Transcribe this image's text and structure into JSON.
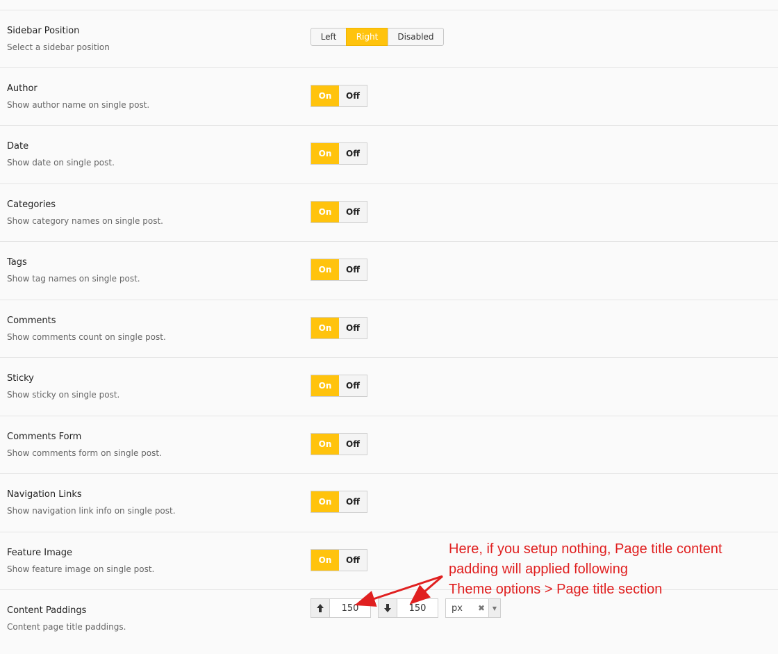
{
  "sidebar_position": {
    "title": "Sidebar Position",
    "description": "Select a sidebar position",
    "options": [
      "Left",
      "Right",
      "Disabled"
    ],
    "selected": "Right"
  },
  "toggles": [
    {
      "title": "Author",
      "description": "Show author name on single post.",
      "on_label": "On",
      "off_label": "Off",
      "state": "On"
    },
    {
      "title": "Date",
      "description": "Show date on single post.",
      "on_label": "On",
      "off_label": "Off",
      "state": "On"
    },
    {
      "title": "Categories",
      "description": "Show category names on single post.",
      "on_label": "On",
      "off_label": "Off",
      "state": "On"
    },
    {
      "title": "Tags",
      "description": "Show tag names on single post.",
      "on_label": "On",
      "off_label": "Off",
      "state": "On"
    },
    {
      "title": "Comments",
      "description": "Show comments count on single post.",
      "on_label": "On",
      "off_label": "Off",
      "state": "On"
    },
    {
      "title": "Sticky",
      "description": "Show sticky on single post.",
      "on_label": "On",
      "off_label": "Off",
      "state": "On"
    },
    {
      "title": "Comments Form",
      "description": "Show comments form on single post.",
      "on_label": "On",
      "off_label": "Off",
      "state": "On"
    },
    {
      "title": "Navigation Links",
      "description": "Show navigation link info on single post.",
      "on_label": "On",
      "off_label": "Off",
      "state": "On"
    },
    {
      "title": "Feature Image",
      "description": "Show feature image on single post.",
      "on_label": "On",
      "off_label": "Off",
      "state": "On"
    }
  ],
  "content_paddings": {
    "title": "Content Paddings",
    "description": "Content page title paddings.",
    "top_value": "150",
    "bottom_value": "150",
    "unit": "px",
    "top_icon": "arrow-up-icon",
    "bottom_icon": "arrow-down-icon"
  },
  "annotation": {
    "lines": [
      "Here, if you setup nothing, Page title content",
      "padding will applied following",
      "Theme options > Page title section"
    ],
    "color": "#e02020"
  },
  "colors": {
    "accent": "#ffc30d"
  }
}
